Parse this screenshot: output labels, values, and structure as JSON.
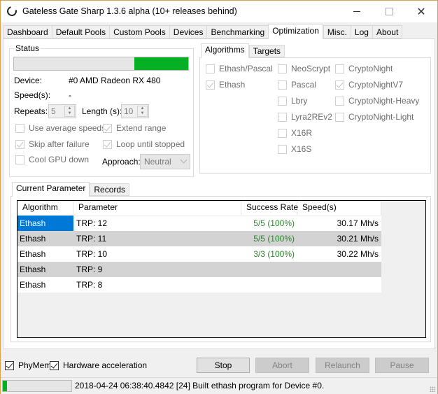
{
  "window": {
    "title": "Gateless Gate Sharp 1.3.6 alpha (10+ releases behind)",
    "controls": {
      "minimize": "minimize",
      "maximize": "maximize",
      "close": "✕"
    }
  },
  "tabs": [
    {
      "label": "Dashboard",
      "active": false
    },
    {
      "label": "Default Pools",
      "active": false
    },
    {
      "label": "Custom Pools",
      "active": false
    },
    {
      "label": "Devices",
      "active": false
    },
    {
      "label": "Benchmarking",
      "active": false
    },
    {
      "label": "Optimization",
      "active": true
    },
    {
      "label": "Misc.",
      "active": false
    },
    {
      "label": "Log",
      "active": false
    },
    {
      "label": "About",
      "active": false
    }
  ],
  "status": {
    "title": "Status",
    "progress_percent": 31,
    "progress_color": "#06b025",
    "device_label": "Device:",
    "device_value": "#0 AMD Radeon RX 480",
    "speeds_label": "Speed(s):",
    "speeds_value": "-",
    "repeats_label": "Repeats:",
    "repeats_value": "5",
    "length_label": "Length (s):",
    "length_value": "10",
    "options": {
      "use_average_speeds": {
        "label": "Use average speeds",
        "checked": false
      },
      "extend_range": {
        "label": "Extend range",
        "checked": true
      },
      "skip_after_failure": {
        "label": "Skip after failure",
        "checked": true
      },
      "loop_until_stopped": {
        "label": "Loop until stopped",
        "checked": true
      },
      "cool_gpu_down": {
        "label": "Cool GPU down",
        "checked": false
      }
    },
    "approach_label": "Approach:",
    "approach_value": "Neutral"
  },
  "algorithm_tabs": [
    {
      "label": "Algorithms",
      "active": true
    },
    {
      "label": "Targets",
      "active": false
    }
  ],
  "algorithms": {
    "col1": [
      {
        "label": "Ethash/Pascal",
        "checked": false
      },
      {
        "label": "Ethash",
        "checked": true
      }
    ],
    "col2": [
      {
        "label": "NeoScrypt",
        "checked": false
      },
      {
        "label": "Pascal",
        "checked": false
      },
      {
        "label": "Lbry",
        "checked": false
      },
      {
        "label": "Lyra2REv2",
        "checked": false
      },
      {
        "label": "X16R",
        "checked": false
      },
      {
        "label": "X16S",
        "checked": false
      }
    ],
    "col3": [
      {
        "label": "CryptoNight",
        "checked": false
      },
      {
        "label": "CryptoNightV7",
        "checked": true
      },
      {
        "label": "CryptoNight-Heavy",
        "checked": false
      },
      {
        "label": "CryptoNight-Light",
        "checked": false
      }
    ]
  },
  "parameter_tabs": [
    {
      "label": "Current Parameter",
      "active": true
    },
    {
      "label": "Records",
      "active": false
    }
  ],
  "table": {
    "columns": [
      "Algorithm",
      "Parameter",
      "Success Rate",
      "Speed(s)"
    ],
    "rows": [
      {
        "algorithm": "Ethash",
        "parameter": "TRP: 12",
        "success_rate": "5/5 (100%)",
        "speed": "30.17 Mh/s",
        "selected": true
      },
      {
        "algorithm": "Ethash",
        "parameter": "TRP: 11",
        "success_rate": "5/5 (100%)",
        "speed": "30.21 Mh/s",
        "selected": false
      },
      {
        "algorithm": "Ethash",
        "parameter": "TRP: 10",
        "success_rate": "3/3 (100%)",
        "speed": "30.22 Mh/s",
        "selected": false
      },
      {
        "algorithm": "Ethash",
        "parameter": "TRP: 9",
        "success_rate": "",
        "speed": "",
        "selected": false
      },
      {
        "algorithm": "Ethash",
        "parameter": "TRP: 8",
        "success_rate": "",
        "speed": "",
        "selected": false
      }
    ],
    "selection_color": "#0078d7",
    "success_color": "#228b22"
  },
  "bottom": {
    "phymem": {
      "label": "PhyMem",
      "checked": true
    },
    "hw_accel": {
      "label": "Hardware acceleration",
      "checked": true
    },
    "buttons": {
      "stop": {
        "label": "Stop",
        "enabled": true
      },
      "abort": {
        "label": "Abort",
        "enabled": false
      },
      "relaunch": {
        "label": "Relaunch",
        "enabled": false
      },
      "pause": {
        "label": "Pause",
        "enabled": false
      }
    }
  },
  "statusbar": {
    "progress_percent": 6,
    "message": "2018-04-24 06:38:40.4842 [24] Built ethash program for Device #0."
  }
}
